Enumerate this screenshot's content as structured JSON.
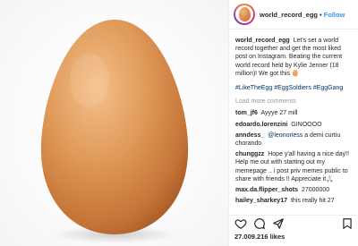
{
  "post": {
    "username": "world_record_egg",
    "separator": "•",
    "follow_label": "Follow",
    "caption": {
      "user": "world_record_egg",
      "text": "Let's set a world record together and get the most liked post on Instagram. Beating the current world record held by Kylie Jenner (18 million)! We got this 🥚",
      "hashtags": "#LikeTheEgg #EggSoldiers #EggGang"
    },
    "load_more_label": "Load more comments",
    "comments": [
      {
        "user": "tom_jf6",
        "text": "Ayyye 27 mill"
      },
      {
        "user": "edoardo.lorenzini",
        "text": "GINOOOO"
      },
      {
        "user": "anndess_",
        "mention": "@leonoriess",
        "text": " a demi curtiu chorando"
      },
      {
        "user": "chunggzz",
        "text": "Hope y'all having a nice day!! Help me out with starting out my memepage .. i post priv memes public to share with friends !! Appreciate it🙏🏻"
      },
      {
        "user": "max.da.flipper_shots",
        "text": "27000000"
      },
      {
        "user": "hailey_sharkey17",
        "text": "this really hit 27 million"
      }
    ],
    "likes": "27.009.216 likes",
    "icons": [
      "heart-icon",
      "comment-icon",
      "share-icon",
      "bookmark-icon"
    ],
    "colors": {
      "link": "#3897f0",
      "hashtag": "#003569",
      "muted": "#999999",
      "egg": "#d98a4a"
    }
  }
}
